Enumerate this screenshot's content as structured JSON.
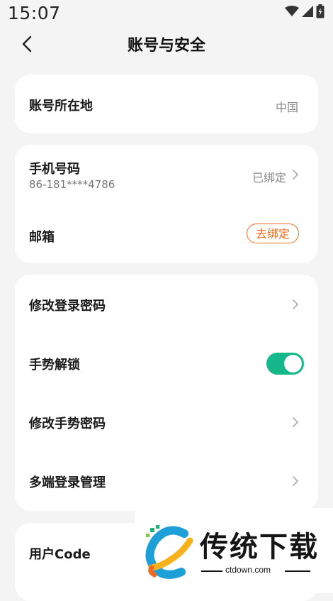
{
  "status_bar": {
    "time": "15:07",
    "icons": [
      "wifi-icon",
      "signal-icon",
      "battery-icon"
    ]
  },
  "nav": {
    "title": "账号与安全",
    "back_icon": "chevron-left-icon"
  },
  "region": {
    "label": "账号所在地",
    "value": "中国"
  },
  "phone": {
    "label": "手机号码",
    "number": "86-181****4786",
    "status": "已绑定"
  },
  "email": {
    "label": "邮箱",
    "action": "去绑定"
  },
  "security": {
    "change_password": "修改登录密码",
    "gesture_unlock": "手势解锁",
    "gesture_unlock_enabled": true,
    "change_gesture": "修改手势密码",
    "multi_login": "多端登录管理"
  },
  "user_code": {
    "label": "用户Code"
  },
  "watermark": {
    "brand": "传统下载",
    "url": "ctdown.com"
  },
  "colors": {
    "accent_orange": "#f06a1c",
    "toggle_green": "#14b88a",
    "background": "#f4f4f4"
  }
}
